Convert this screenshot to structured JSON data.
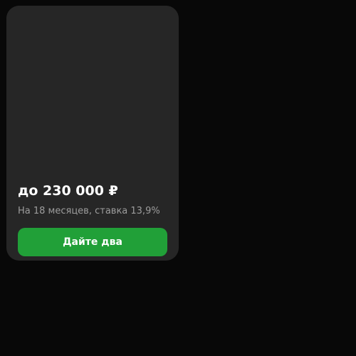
{
  "card": {
    "amount": "до 230 000 ₽",
    "terms": "На 18 месяцев, ставка 13,9%",
    "button_label": "Дайте два"
  },
  "colors": {
    "background": "#080808",
    "card": "#262626",
    "button": "#21a038",
    "text_primary": "#ffffff",
    "text_secondary": "#9d9d9d"
  }
}
